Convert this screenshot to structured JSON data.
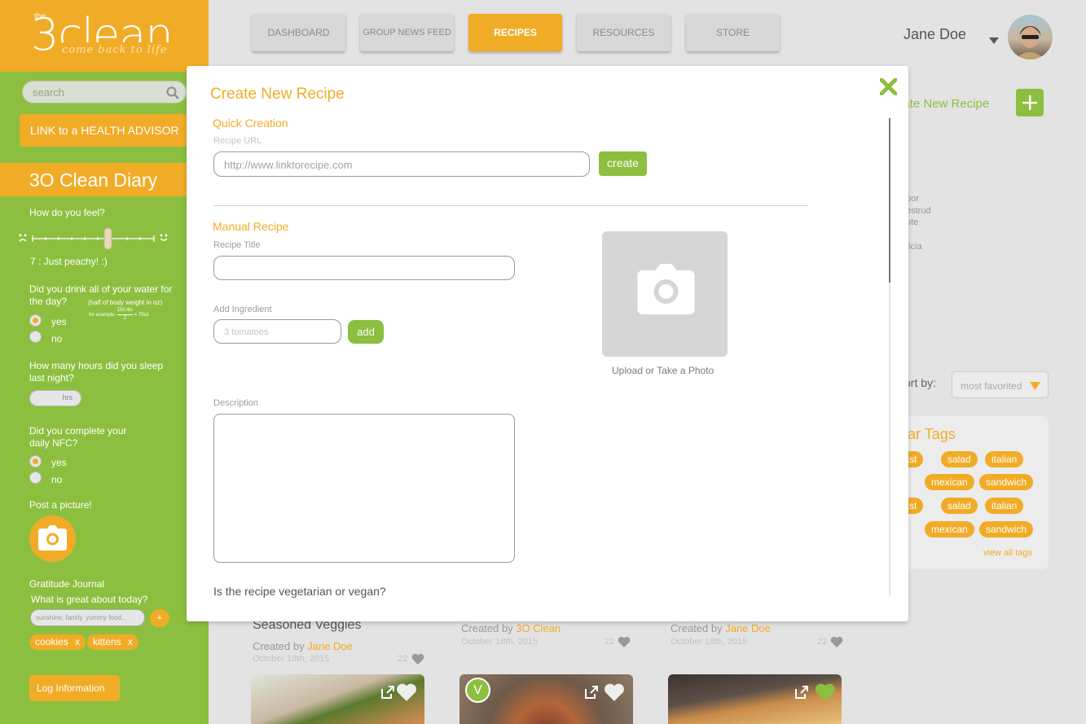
{
  "brand": {
    "the": "the",
    "number": "3",
    "word": "clean",
    "tagline": "come back to life"
  },
  "sidebar": {
    "search_placeholder": "search",
    "advisor_button": "LINK to a HEALTH ADVISOR",
    "diary_title": "3O Clean Diary",
    "feel_question": "How do you feel?",
    "feel_value": "7 : Just peachy!  :)",
    "water_question": "Did you drink all of your water for the day?",
    "water_hint": "(half of body weight in oz)",
    "water_example_prefix": "for example:",
    "water_example_num": "150 lbs",
    "water_example_den": "2",
    "water_example_result": "= 75oz",
    "yes": "yes",
    "no": "no",
    "sleep_question": "How many hours did you sleep last night?",
    "sleep_unit": "hrs",
    "nfc_question_1": "Did you complete your",
    "nfc_question_2": "daily NFC?",
    "picture_label": "Post a picture!",
    "gratitude_title": "Gratitude Journal",
    "gratitude_question": "What is great about today?",
    "gratitude_placeholder": "sunshine, family, yummy food...",
    "gratitude_add": "+",
    "gratitude_tags": [
      "cookies",
      "kittens"
    ],
    "remove_x": "x",
    "log_button": "Log Information"
  },
  "nav": {
    "items": [
      "DASHBOARD",
      "GROUP NEWS FEED",
      "RECIPES",
      "RESOURCES",
      "STORE"
    ],
    "active": "RECIPES"
  },
  "user": {
    "name": "Jane Doe"
  },
  "background": {
    "create_new_recipe": "eate New Recipe",
    "lorem": [
      "por",
      "ostrud",
      "ute",
      "ficia"
    ],
    "sort_label": "ort by:",
    "sort_value": "most favorited",
    "tags_title": "ular Tags",
    "tags_row1": [
      "kfast",
      "salad",
      "italian"
    ],
    "tags_row2": [
      "rt",
      "mexican",
      "sandwich"
    ],
    "tags_row3": [
      "kfast",
      "salad",
      "italian"
    ],
    "tags_row4": [
      "rt",
      "mexican",
      "sandwich"
    ],
    "view_all_tags": "view all tags",
    "cards": [
      {
        "title": "Seasoned Veggies",
        "created_by": "Created by",
        "author": "Jane Doe",
        "date": "October 18th, 2015",
        "likes": "22"
      },
      {
        "title": "",
        "created_by": "Created by",
        "author": "3O Clean",
        "date": "October 18th, 2015",
        "likes": "22"
      },
      {
        "title": "",
        "created_by": "Created by",
        "author": "Jane Doe",
        "date": "October 18th, 2015",
        "likes": "22"
      }
    ],
    "vegan_badge": "V"
  },
  "modal": {
    "title": "Create New Recipe",
    "quick_title": "Quick Creation",
    "url_label": "Recipe URL",
    "url_placeholder": "http://www.linktorecipe.com",
    "create_button": "create",
    "manual_title": "Manual Recipe",
    "recipe_title_label": "Recipe Title",
    "ingredient_label": "Add Ingredient",
    "ingredient_placeholder": "3 tomatoes",
    "add_button": "add",
    "photo_label": "Upload or Take a Photo",
    "description_label": "Description",
    "vegetarian_question": "Is the recipe vegetarian or vegan?"
  },
  "colors": {
    "orange": "#f1ac27",
    "green": "#8cbf3f"
  }
}
